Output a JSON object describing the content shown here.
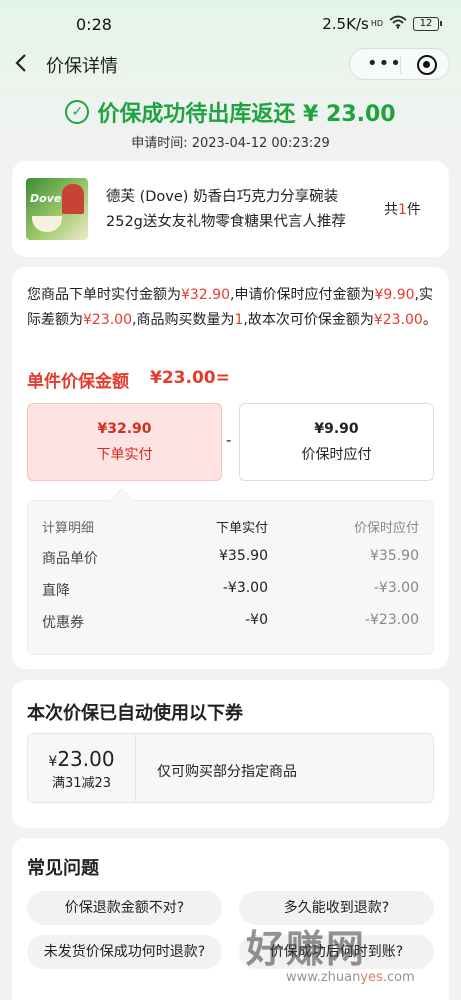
{
  "status_bar": {
    "time": "0:28",
    "speed": "2.5K/s",
    "net": "HD",
    "battery": "12"
  },
  "nav": {
    "title": "价保详情",
    "capsule_more": "•••"
  },
  "result": {
    "text": "价保成功待出库返还 ¥ 23.00",
    "apply_time": "申请时间: 2023-04-12 00:23:29"
  },
  "product": {
    "title": "德芙 (Dove) 奶香白巧克力分享碗装252g送女友礼物零食糖果代言人推荐",
    "count_prefix": "共",
    "count": "1",
    "count_suffix": "件",
    "image_text": "Dove"
  },
  "calc": {
    "explain": {
      "p1": "您商品下单时实付金额为",
      "v1": "¥32.90",
      "p2": ",申请价保时应付金额为",
      "v2": "¥9.90",
      "p3": ",实际差额为",
      "v3": "¥23.00",
      "p4": ",商品购买数量为",
      "v4": "1",
      "p5": ",故本次可价保金额为",
      "v5": "¥23.00",
      "p6": "。"
    },
    "unit_label": "单件价保金额",
    "unit_amount": "¥23.00=",
    "order_box": {
      "amount": "¥32.90",
      "label": "下单实付"
    },
    "minus": "-",
    "current_box": {
      "amount": "¥9.90",
      "label": "价保时应付"
    },
    "table": {
      "headers": [
        "计算明细",
        "下单实付",
        "价保时应付"
      ],
      "rows": [
        [
          "商品单价",
          "¥35.90",
          "¥35.90"
        ],
        [
          "直降",
          "-¥3.00",
          "-¥3.00"
        ],
        [
          "优惠券",
          "-¥0",
          "-¥23.00"
        ]
      ]
    }
  },
  "coupon": {
    "heading": "本次价保已自动使用以下券",
    "currency": "¥",
    "amount": "23.00",
    "condition": "满31减23",
    "description": "仅可购买部分指定商品"
  },
  "faq": {
    "heading": "常见问题",
    "items": [
      "价保退款金额不对?",
      "多久能收到退款?",
      "未发货价保成功何时退款?",
      "价保成功后何时到账?"
    ]
  },
  "watermark": {
    "text": "好赚网",
    "url_a": "www.zhuan",
    "url_b": "yes",
    "url_c": ".com"
  },
  "colors": {
    "accent_green": "#1fa33f",
    "accent_red": "#e53b2d"
  }
}
